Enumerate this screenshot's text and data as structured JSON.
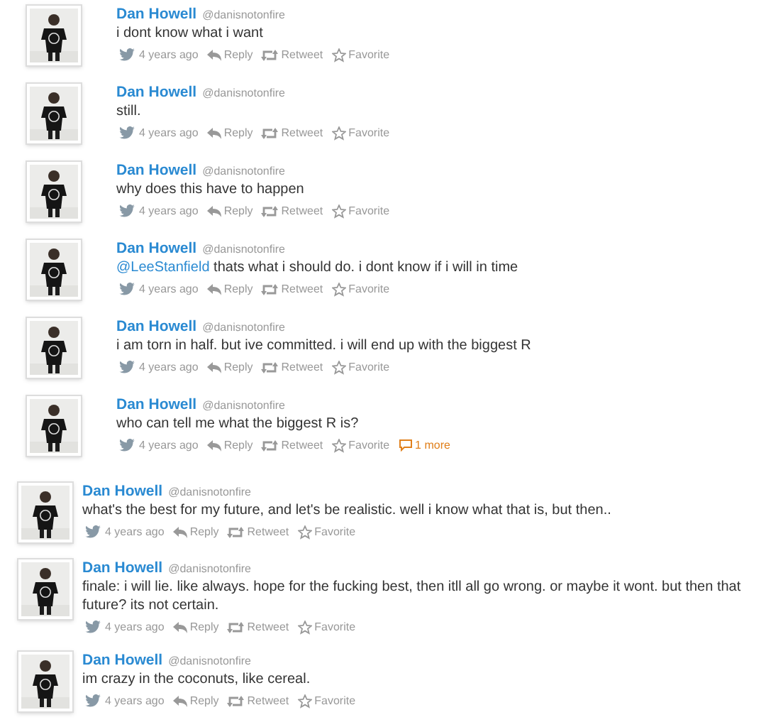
{
  "groups": [
    {
      "tweets": [
        {
          "name": "Dan Howell",
          "handle": "@danisnotonfire",
          "text": "i dont know what i want",
          "time": "4 years ago",
          "actions": [
            {
              "kind": "reply",
              "label": "Reply"
            },
            {
              "kind": "retweet",
              "label": "Retweet"
            },
            {
              "kind": "favorite",
              "label": "Favorite"
            }
          ]
        },
        {
          "name": "Dan Howell",
          "handle": "@danisnotonfire",
          "text": "still.",
          "time": "4 years ago",
          "actions": [
            {
              "kind": "reply",
              "label": "Reply"
            },
            {
              "kind": "retweet",
              "label": "Retweet"
            },
            {
              "kind": "favorite",
              "label": "Favorite"
            }
          ]
        },
        {
          "name": "Dan Howell",
          "handle": "@danisnotonfire",
          "text": "why does this have to happen",
          "time": "4 years ago",
          "actions": [
            {
              "kind": "reply",
              "label": "Reply"
            },
            {
              "kind": "retweet",
              "label": "Retweet"
            },
            {
              "kind": "favorite",
              "label": "Favorite"
            }
          ]
        },
        {
          "name": "Dan Howell",
          "handle": "@danisnotonfire",
          "mention": "@LeeStanfield",
          "text": "thats what i should do. i dont know if i will in time",
          "time": "4 years ago",
          "actions": [
            {
              "kind": "reply",
              "label": "Reply"
            },
            {
              "kind": "retweet",
              "label": "Retweet"
            },
            {
              "kind": "favorite",
              "label": "Favorite"
            }
          ]
        },
        {
          "name": "Dan Howell",
          "handle": "@danisnotonfire",
          "text": "i am torn in half. but ive committed. i will end up with the biggest R",
          "time": "4 years ago",
          "actions": [
            {
              "kind": "reply",
              "label": "Reply"
            },
            {
              "kind": "retweet",
              "label": "Retweet"
            },
            {
              "kind": "favorite",
              "label": "Favorite"
            }
          ]
        },
        {
          "name": "Dan Howell",
          "handle": "@danisnotonfire",
          "text": "who can tell me what the biggest R is?",
          "time": "4 years ago",
          "actions": [
            {
              "kind": "reply",
              "label": "Reply"
            },
            {
              "kind": "retweet",
              "label": "Retweet"
            },
            {
              "kind": "favorite",
              "label": "Favorite"
            },
            {
              "kind": "more",
              "label": "1 more"
            }
          ]
        }
      ]
    },
    {
      "tweets": [
        {
          "name": "Dan Howell",
          "handle": "@danisnotonfire",
          "text": "what's the best for my future, and let's be realistic. well i know what that is, but then..",
          "time": "4 years ago",
          "actions": [
            {
              "kind": "reply",
              "label": "Reply"
            },
            {
              "kind": "retweet",
              "label": "Retweet"
            },
            {
              "kind": "favorite",
              "label": "Favorite"
            }
          ]
        },
        {
          "name": "Dan Howell",
          "handle": "@danisnotonfire",
          "text": "finale: i will lie. like always. hope for the fucking best, then itll all go wrong. or maybe it wont. but then that future? its not certain.",
          "time": "4 years ago",
          "actions": [
            {
              "kind": "reply",
              "label": "Reply"
            },
            {
              "kind": "retweet",
              "label": "Retweet"
            },
            {
              "kind": "favorite",
              "label": "Favorite"
            }
          ]
        },
        {
          "name": "Dan Howell",
          "handle": "@danisnotonfire",
          "text": "im crazy in the coconuts, like cereal.",
          "time": "4 years ago",
          "actions": [
            {
              "kind": "reply",
              "label": "Reply"
            },
            {
              "kind": "retweet",
              "label": "Retweet"
            },
            {
              "kind": "favorite",
              "label": "Favorite"
            }
          ]
        }
      ]
    }
  ]
}
